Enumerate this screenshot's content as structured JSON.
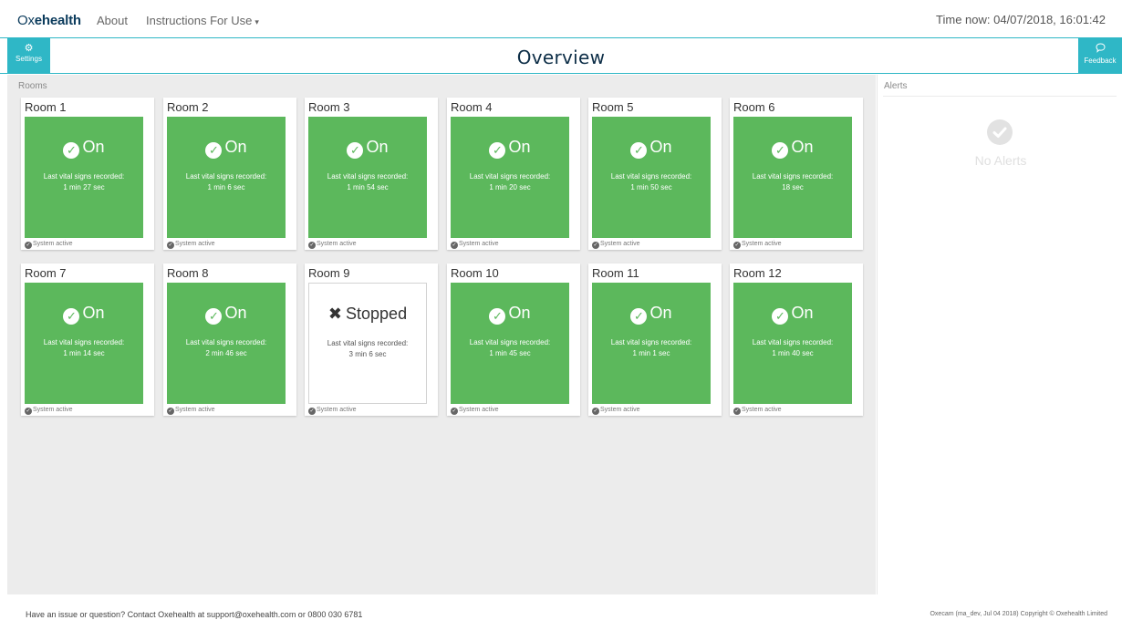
{
  "nav": {
    "brand_prefix": "Ox",
    "brand_bold": "ehealth",
    "about": "About",
    "instructions": "Instructions For Use",
    "time_now": "Time now: 04/07/2018, 16:01:42"
  },
  "header": {
    "settings_label": "Settings",
    "title": "Overview",
    "feedback_label": "Feedback"
  },
  "rooms": {
    "heading": "Rooms",
    "items": [
      {
        "name": "Room 1",
        "status": "On",
        "vital_label": "Last vital signs recorded:",
        "vital_value": "1 min 27 sec",
        "footer": "System active"
      },
      {
        "name": "Room 2",
        "status": "On",
        "vital_label": "Last vital signs recorded:",
        "vital_value": "1 min 6 sec",
        "footer": "System active"
      },
      {
        "name": "Room 3",
        "status": "On",
        "vital_label": "Last vital signs recorded:",
        "vital_value": "1 min 54 sec",
        "footer": "System active"
      },
      {
        "name": "Room 4",
        "status": "On",
        "vital_label": "Last vital signs recorded:",
        "vital_value": "1 min 20 sec",
        "footer": "System active"
      },
      {
        "name": "Room 5",
        "status": "On",
        "vital_label": "Last vital signs recorded:",
        "vital_value": "1 min 50 sec",
        "footer": "System active"
      },
      {
        "name": "Room 6",
        "status": "On",
        "vital_label": "Last vital signs recorded:",
        "vital_value": "18 sec",
        "footer": "System active"
      },
      {
        "name": "Room 7",
        "status": "On",
        "vital_label": "Last vital signs recorded:",
        "vital_value": "1 min 14 sec",
        "footer": "System active"
      },
      {
        "name": "Room 8",
        "status": "On",
        "vital_label": "Last vital signs recorded:",
        "vital_value": "2 min 46 sec",
        "footer": "System active"
      },
      {
        "name": "Room 9",
        "status": "Stopped",
        "vital_label": "Last vital signs recorded:",
        "vital_value": "3 min 6 sec",
        "footer": "System active"
      },
      {
        "name": "Room 10",
        "status": "On",
        "vital_label": "Last vital signs recorded:",
        "vital_value": "1 min 45 sec",
        "footer": "System active"
      },
      {
        "name": "Room 11",
        "status": "On",
        "vital_label": "Last vital signs recorded:",
        "vital_value": "1 min 1 sec",
        "footer": "System active"
      },
      {
        "name": "Room 12",
        "status": "On",
        "vital_label": "Last vital signs recorded:",
        "vital_value": "1 min 40 sec",
        "footer": "System active"
      }
    ]
  },
  "alerts": {
    "heading": "Alerts",
    "empty_text": "No Alerts"
  },
  "footer": {
    "contact": "Have an issue or question? Contact Oxehealth at support@oxehealth.com or 0800 030 6781",
    "copyright": "Oxecam (ma_dev, Jul 04 2018) Copyright © Oxehealth Limited"
  },
  "colors": {
    "accent": "#2fb7c6",
    "status_on": "#5cb85c",
    "panel_bg": "#ececec"
  },
  "icons": {
    "settings": "gears-icon",
    "feedback": "comment-icon",
    "on": "check-circle-icon",
    "stopped": "x-icon"
  }
}
